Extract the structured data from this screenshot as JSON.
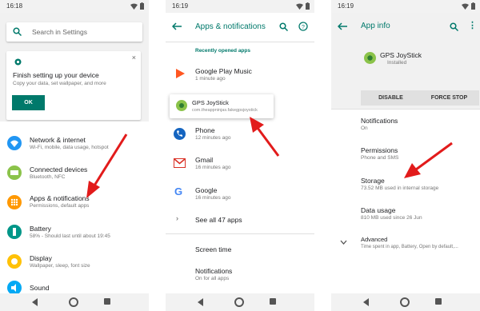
{
  "colors": {
    "accent": "#00796b",
    "arrow": "#e21b1b"
  },
  "phone1": {
    "time": "16:18",
    "search_placeholder": "Search in Settings",
    "card": {
      "title": "Finish setting up your device",
      "subtitle": "Copy your data, set wallpaper, and more",
      "ok": "OK"
    },
    "items": [
      {
        "title": "Network & internet",
        "subtitle": "Wi-Fi, mobile, data usage, hotspot",
        "icon": "wifi-icon",
        "color": "#2196f3"
      },
      {
        "title": "Connected devices",
        "subtitle": "Bluetooth, NFC",
        "icon": "devices-icon",
        "color": "#8bc34a"
      },
      {
        "title": "Apps & notifications",
        "subtitle": "Permissions, default apps",
        "icon": "apps-icon",
        "color": "#ff9800"
      },
      {
        "title": "Battery",
        "subtitle": "58% - Should last until about 19:45",
        "icon": "battery-icon",
        "color": "#009688"
      },
      {
        "title": "Display",
        "subtitle": "Wallpaper, sleep, font size",
        "icon": "brightness-icon",
        "color": "#ffc107"
      },
      {
        "title": "Sound",
        "subtitle": "",
        "icon": "sound-icon",
        "color": "#03a9f4"
      }
    ]
  },
  "phone2": {
    "time": "16:19",
    "title": "Apps & notifications",
    "section": "Recently opened apps",
    "apps": [
      {
        "name": "Google Play Music",
        "time": "1 minute ago",
        "icon": "play-music-icon"
      },
      {
        "name": "GPS JoyStick",
        "time": "com.theappninjas.fakegpsjoystick",
        "icon": "gps-joystick-icon"
      },
      {
        "name": "Phone",
        "time": "12 minutes ago",
        "icon": "phone-icon"
      },
      {
        "name": "Gmail",
        "time": "16 minutes ago",
        "icon": "gmail-icon"
      },
      {
        "name": "Google",
        "time": "16 minutes ago",
        "icon": "google-icon"
      }
    ],
    "see_all": "See all 47 apps",
    "screen_time": "Screen time",
    "notifications": {
      "title": "Notifications",
      "subtitle": "On for all apps"
    }
  },
  "phone3": {
    "time": "16:19",
    "title": "App info",
    "app_name": "GPS JoyStick",
    "app_status": "Installed",
    "disable": "DISABLE",
    "force_stop": "FORCE STOP",
    "items": [
      {
        "title": "Notifications",
        "subtitle": "On"
      },
      {
        "title": "Permissions",
        "subtitle": "Phone and SMS"
      },
      {
        "title": "Storage",
        "subtitle": "73.52 MB used in internal storage"
      },
      {
        "title": "Data usage",
        "subtitle": "810 MB used since 26 Jun"
      },
      {
        "title": "Advanced",
        "subtitle": "Time spent in app, Battery, Open by default,..."
      }
    ]
  }
}
